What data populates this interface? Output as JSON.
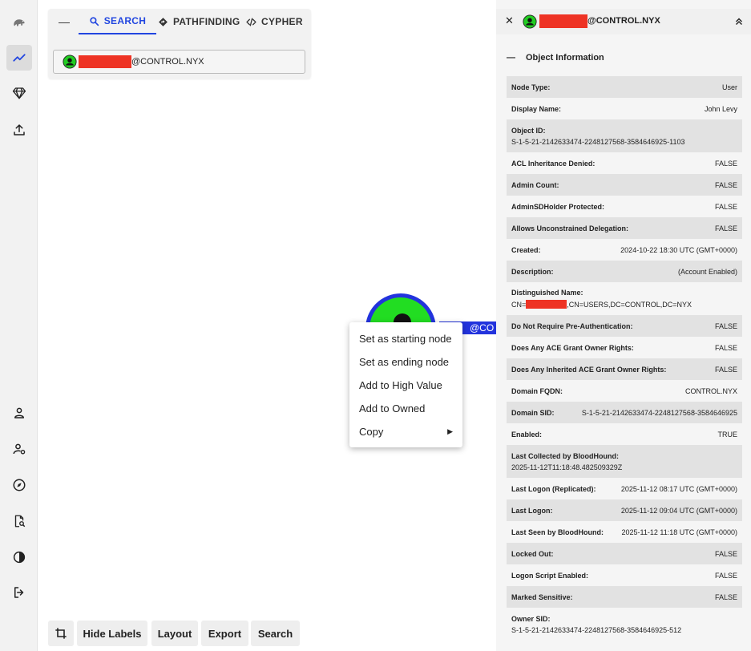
{
  "search_panel": {
    "tabs": [
      {
        "label": "SEARCH",
        "icon": "search-icon",
        "active": true
      },
      {
        "label": "PATHFINDING",
        "icon": "diamond-direction-icon",
        "active": false
      },
      {
        "label": "CYPHER",
        "icon": "code-icon",
        "active": false
      }
    ],
    "search_value_suffix": "@CONTROL.NYX"
  },
  "graph": {
    "node_label_visible": "@CO",
    "node_color": "#22dd22",
    "selected_color": "#2233dd"
  },
  "context_menu": {
    "items": [
      "Set as starting node",
      "Set as ending node",
      "Add to High Value",
      "Add to Owned",
      "Copy"
    ]
  },
  "toolbar": {
    "hide_labels": "Hide Labels",
    "layout": "Layout",
    "export": "Export",
    "search": "Search"
  },
  "right_panel": {
    "title_suffix": "@CONTROL.NYX",
    "section_title": "Object Information",
    "properties": [
      {
        "key": "Node Type:",
        "value": "User"
      },
      {
        "key": "Display Name:",
        "value": "John Levy"
      },
      {
        "key": "Object ID:",
        "value": "S-1-5-21-2142633474-2248127568-3584646925-1103"
      },
      {
        "key": "ACL Inheritance Denied:",
        "value": "FALSE"
      },
      {
        "key": "Admin Count:",
        "value": "FALSE"
      },
      {
        "key": "AdminSDHolder Protected:",
        "value": "FALSE"
      },
      {
        "key": "Allows Unconstrained Delegation:",
        "value": "FALSE"
      },
      {
        "key": "Created:",
        "value": "2024-10-22 18:30 UTC (GMT+0000)"
      },
      {
        "key": "Description:",
        "value": "(Account Enabled)"
      },
      {
        "key": "Distinguished Name:",
        "value_prefix": "CN=",
        "value_suffix": ",CN=USERS,DC=CONTROL,DC=NYX"
      },
      {
        "key": "Do Not Require Pre-Authentication:",
        "value": "FALSE"
      },
      {
        "key": "Does Any ACE Grant Owner Rights:",
        "value": "FALSE"
      },
      {
        "key": "Does Any Inherited ACE Grant Owner Rights:",
        "value": "FALSE"
      },
      {
        "key": "Domain FQDN:",
        "value": "CONTROL.NYX"
      },
      {
        "key": "Domain SID:",
        "value": "S-1-5-21-2142633474-2248127568-3584646925"
      },
      {
        "key": "Enabled:",
        "value": "TRUE"
      },
      {
        "key": "Last Collected by BloodHound:",
        "value": "2025-11-12T11:18:48.482509329Z"
      },
      {
        "key": "Last Logon (Replicated):",
        "value": "2025-11-12 08:17 UTC (GMT+0000)"
      },
      {
        "key": "Last Logon:",
        "value": "2025-11-12 09:04 UTC (GMT+0000)"
      },
      {
        "key": "Last Seen by BloodHound:",
        "value": "2025-11-12 11:18 UTC (GMT+0000)"
      },
      {
        "key": "Locked Out:",
        "value": "FALSE"
      },
      {
        "key": "Logon Script Enabled:",
        "value": "FALSE"
      },
      {
        "key": "Marked Sensitive:",
        "value": "FALSE"
      },
      {
        "key": "Owner SID:",
        "value": "S-1-5-21-2142633474-2248127568-3584646925-512"
      }
    ]
  }
}
